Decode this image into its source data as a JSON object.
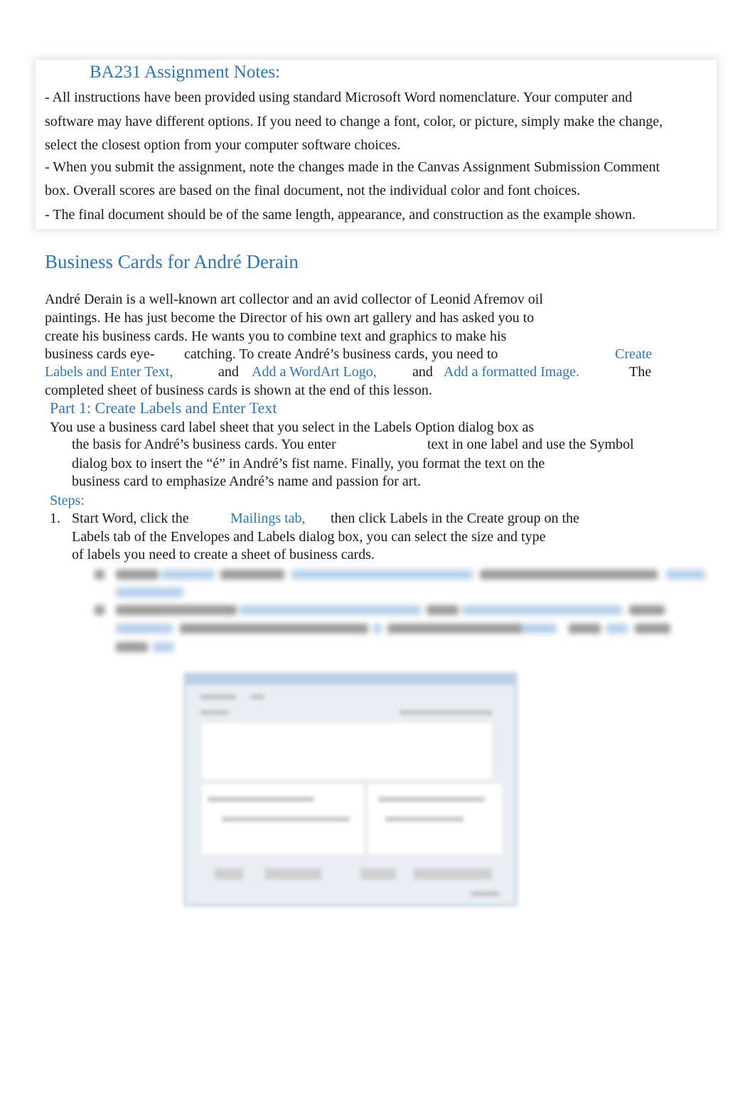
{
  "notes": {
    "title": "BA231 Assignment Notes:",
    "lines": [
      "- All instructions have been provided using standard Microsoft Word nomenclature. Your computer and",
      "software may have different options. If you need to change a font, color, or picture, simply make the change,",
      "select the closest option from your computer software choices.",
      "- When you submit the assignment, note the changes made in the Canvas Assignment Submission Comment",
      "box. Overall scores are based on the final document, not the individual color and font choices.",
      "- The final document should be of the same length, appearance, and construction as the example shown."
    ]
  },
  "heading": "Business Cards for André Derain",
  "intro": {
    "line1": "André Derain is a well-known art collector and an avid collector of Leonid Afremov oil",
    "line2": "paintings. He has just become the Director of his own art gallery and has asked you to",
    "line3": "create his business cards. He wants you to combine text and graphics to make his",
    "line4a": "business cards eye-",
    "line4b": "catching. To create André’s business cards, you need to",
    "line4c": "Create",
    "line5a": "Labels and Enter Text,",
    "line5b": "and",
    "line5c": "Add a WordArt Logo,",
    "line5d": "and",
    "line5e": "Add a formatted Image.",
    "line5f": "The",
    "line6": "completed sheet of business cards is shown at the end of this lesson."
  },
  "part1": {
    "heading": "Part 1: Create Labels and Enter Text",
    "line1": "You use a business card label sheet that you select in the Labels Option dialog box as",
    "line2a": "the basis for André’s business cards. You enter",
    "line2b": "text in one label and use the Symbol",
    "line3": "dialog box to insert the “é” in André’s fist name. Finally, you format the text on the",
    "line4": "business card to emphasize André’s name and passion for art."
  },
  "steps": {
    "label": "Steps:",
    "items": [
      {
        "number": "1.",
        "line1a": "Start Word, click the",
        "line1b": "Mailings tab,",
        "line1c": "then click Labels in the Create group on the",
        "line2": "Labels tab of the Envelopes and Labels dialog box, you can select the size and type",
        "line3": "of labels you need to create a sheet of business cards."
      }
    ]
  },
  "colors": {
    "accent_blue": "#2e74b5",
    "body_text": "#1a1a1a"
  }
}
